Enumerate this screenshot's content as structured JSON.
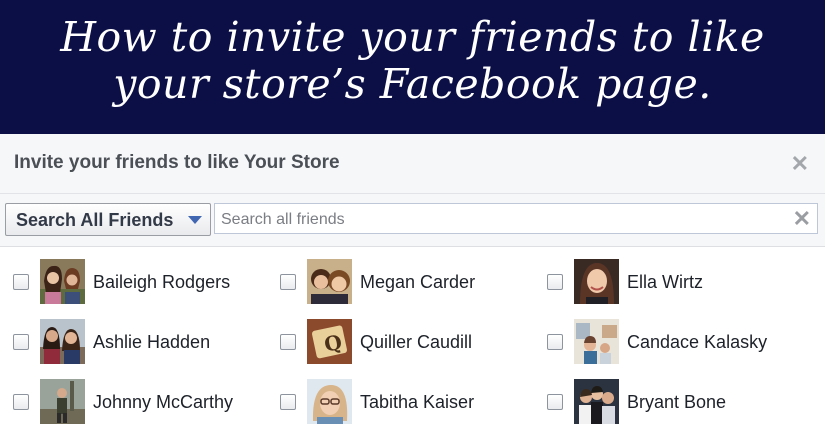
{
  "banner": {
    "line1": "How to invite your friends to like",
    "line2": "your store’s Facebook page."
  },
  "dialog": {
    "title": "Invite your friends to like Your Store",
    "close_icon": "close-icon"
  },
  "filter": {
    "selected": "Search All Friends",
    "dropdown_icon": "caret-down-icon"
  },
  "search": {
    "placeholder": "Search all friends",
    "value": "",
    "clear_icon": "clear-icon"
  },
  "friends": [
    {
      "name": "Baileigh Rodgers",
      "checked": false
    },
    {
      "name": "Megan Carder",
      "checked": false
    },
    {
      "name": "Ella Wirtz",
      "checked": false
    },
    {
      "name": "Ashlie Hadden",
      "checked": false
    },
    {
      "name": "Quiller Caudill",
      "checked": false
    },
    {
      "name": "Candace Kalasky",
      "checked": false
    },
    {
      "name": "Johnny McCarthy",
      "checked": false
    },
    {
      "name": "Tabitha Kaiser",
      "checked": false
    },
    {
      "name": "Bryant Bone",
      "checked": false
    }
  ]
}
